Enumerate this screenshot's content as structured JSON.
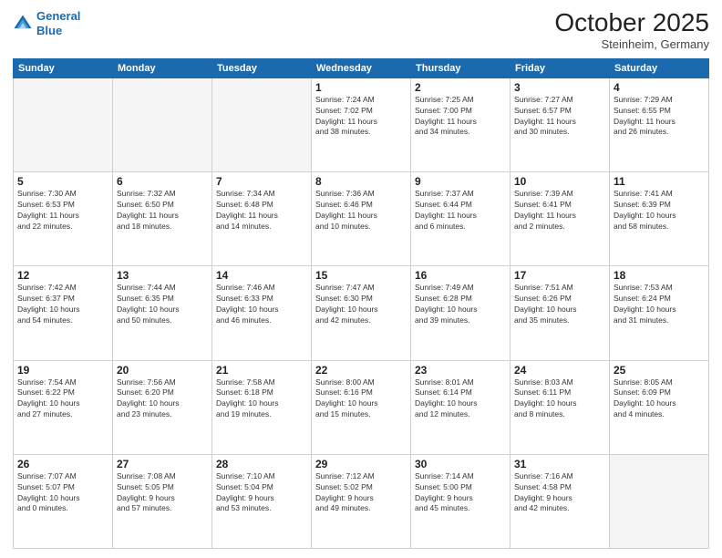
{
  "header": {
    "logo_line1": "General",
    "logo_line2": "Blue",
    "title": "October 2025",
    "subtitle": "Steinheim, Germany"
  },
  "days_of_week": [
    "Sunday",
    "Monday",
    "Tuesday",
    "Wednesday",
    "Thursday",
    "Friday",
    "Saturday"
  ],
  "weeks": [
    [
      {
        "day": "",
        "info": ""
      },
      {
        "day": "",
        "info": ""
      },
      {
        "day": "",
        "info": ""
      },
      {
        "day": "1",
        "info": "Sunrise: 7:24 AM\nSunset: 7:02 PM\nDaylight: 11 hours\nand 38 minutes."
      },
      {
        "day": "2",
        "info": "Sunrise: 7:25 AM\nSunset: 7:00 PM\nDaylight: 11 hours\nand 34 minutes."
      },
      {
        "day": "3",
        "info": "Sunrise: 7:27 AM\nSunset: 6:57 PM\nDaylight: 11 hours\nand 30 minutes."
      },
      {
        "day": "4",
        "info": "Sunrise: 7:29 AM\nSunset: 6:55 PM\nDaylight: 11 hours\nand 26 minutes."
      }
    ],
    [
      {
        "day": "5",
        "info": "Sunrise: 7:30 AM\nSunset: 6:53 PM\nDaylight: 11 hours\nand 22 minutes."
      },
      {
        "day": "6",
        "info": "Sunrise: 7:32 AM\nSunset: 6:50 PM\nDaylight: 11 hours\nand 18 minutes."
      },
      {
        "day": "7",
        "info": "Sunrise: 7:34 AM\nSunset: 6:48 PM\nDaylight: 11 hours\nand 14 minutes."
      },
      {
        "day": "8",
        "info": "Sunrise: 7:36 AM\nSunset: 6:46 PM\nDaylight: 11 hours\nand 10 minutes."
      },
      {
        "day": "9",
        "info": "Sunrise: 7:37 AM\nSunset: 6:44 PM\nDaylight: 11 hours\nand 6 minutes."
      },
      {
        "day": "10",
        "info": "Sunrise: 7:39 AM\nSunset: 6:41 PM\nDaylight: 11 hours\nand 2 minutes."
      },
      {
        "day": "11",
        "info": "Sunrise: 7:41 AM\nSunset: 6:39 PM\nDaylight: 10 hours\nand 58 minutes."
      }
    ],
    [
      {
        "day": "12",
        "info": "Sunrise: 7:42 AM\nSunset: 6:37 PM\nDaylight: 10 hours\nand 54 minutes."
      },
      {
        "day": "13",
        "info": "Sunrise: 7:44 AM\nSunset: 6:35 PM\nDaylight: 10 hours\nand 50 minutes."
      },
      {
        "day": "14",
        "info": "Sunrise: 7:46 AM\nSunset: 6:33 PM\nDaylight: 10 hours\nand 46 minutes."
      },
      {
        "day": "15",
        "info": "Sunrise: 7:47 AM\nSunset: 6:30 PM\nDaylight: 10 hours\nand 42 minutes."
      },
      {
        "day": "16",
        "info": "Sunrise: 7:49 AM\nSunset: 6:28 PM\nDaylight: 10 hours\nand 39 minutes."
      },
      {
        "day": "17",
        "info": "Sunrise: 7:51 AM\nSunset: 6:26 PM\nDaylight: 10 hours\nand 35 minutes."
      },
      {
        "day": "18",
        "info": "Sunrise: 7:53 AM\nSunset: 6:24 PM\nDaylight: 10 hours\nand 31 minutes."
      }
    ],
    [
      {
        "day": "19",
        "info": "Sunrise: 7:54 AM\nSunset: 6:22 PM\nDaylight: 10 hours\nand 27 minutes."
      },
      {
        "day": "20",
        "info": "Sunrise: 7:56 AM\nSunset: 6:20 PM\nDaylight: 10 hours\nand 23 minutes."
      },
      {
        "day": "21",
        "info": "Sunrise: 7:58 AM\nSunset: 6:18 PM\nDaylight: 10 hours\nand 19 minutes."
      },
      {
        "day": "22",
        "info": "Sunrise: 8:00 AM\nSunset: 6:16 PM\nDaylight: 10 hours\nand 15 minutes."
      },
      {
        "day": "23",
        "info": "Sunrise: 8:01 AM\nSunset: 6:14 PM\nDaylight: 10 hours\nand 12 minutes."
      },
      {
        "day": "24",
        "info": "Sunrise: 8:03 AM\nSunset: 6:11 PM\nDaylight: 10 hours\nand 8 minutes."
      },
      {
        "day": "25",
        "info": "Sunrise: 8:05 AM\nSunset: 6:09 PM\nDaylight: 10 hours\nand 4 minutes."
      }
    ],
    [
      {
        "day": "26",
        "info": "Sunrise: 7:07 AM\nSunset: 5:07 PM\nDaylight: 10 hours\nand 0 minutes."
      },
      {
        "day": "27",
        "info": "Sunrise: 7:08 AM\nSunset: 5:05 PM\nDaylight: 9 hours\nand 57 minutes."
      },
      {
        "day": "28",
        "info": "Sunrise: 7:10 AM\nSunset: 5:04 PM\nDaylight: 9 hours\nand 53 minutes."
      },
      {
        "day": "29",
        "info": "Sunrise: 7:12 AM\nSunset: 5:02 PM\nDaylight: 9 hours\nand 49 minutes."
      },
      {
        "day": "30",
        "info": "Sunrise: 7:14 AM\nSunset: 5:00 PM\nDaylight: 9 hours\nand 45 minutes."
      },
      {
        "day": "31",
        "info": "Sunrise: 7:16 AM\nSunset: 4:58 PM\nDaylight: 9 hours\nand 42 minutes."
      },
      {
        "day": "",
        "info": ""
      }
    ]
  ]
}
